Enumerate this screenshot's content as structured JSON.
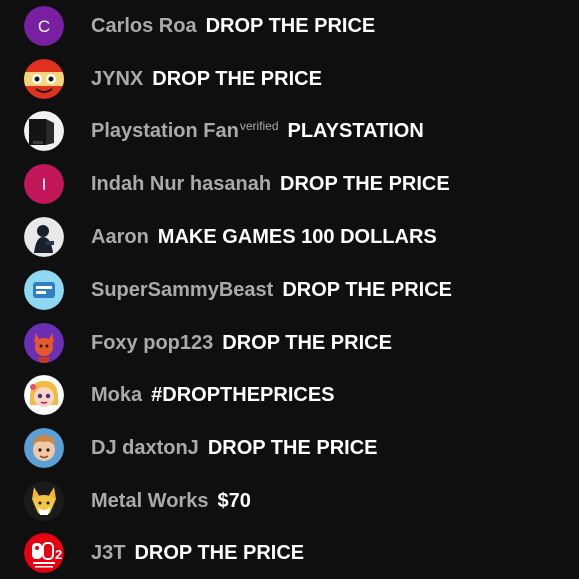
{
  "chat": {
    "messages": [
      {
        "author": "Carlos Roa",
        "badge": "",
        "text": "DROP THE PRICE",
        "avatar": {
          "kind": "letter",
          "letter": "C",
          "color": "#7b1fa2"
        }
      },
      {
        "author": "JYNX",
        "badge": "",
        "text": "DROP THE PRICE",
        "avatar": {
          "kind": "image",
          "icon": "orange-character-avatar-icon"
        }
      },
      {
        "author": "Playstation Fan",
        "badge": "verified",
        "text": "PLAYSTATION",
        "avatar": {
          "kind": "image",
          "icon": "playstation-console-avatar-icon"
        }
      },
      {
        "author": "Indah Nur hasanah",
        "badge": "",
        "text": "DROP THE PRICE",
        "avatar": {
          "kind": "letter",
          "letter": "I",
          "color": "#c2185b"
        }
      },
      {
        "author": "Aaron",
        "badge": "",
        "text": "MAKE GAMES 100 DOLLARS",
        "avatar": {
          "kind": "image",
          "icon": "dark-figure-avatar-icon"
        }
      },
      {
        "author": "SuperSammyBeast",
        "badge": "",
        "text": "DROP THE PRICE",
        "avatar": {
          "kind": "image",
          "icon": "blue-logo-avatar-icon"
        }
      },
      {
        "author": "Foxy pop123",
        "badge": "",
        "text": "DROP THE PRICE",
        "avatar": {
          "kind": "image",
          "icon": "fox-character-avatar-icon"
        }
      },
      {
        "author": "Moka",
        "badge": "",
        "text": "#DROPTHEPRICES",
        "avatar": {
          "kind": "image",
          "icon": "anime-girl-avatar-icon"
        }
      },
      {
        "author": "DJ daxtonJ",
        "badge": "",
        "text": "DROP THE PRICE",
        "avatar": {
          "kind": "image",
          "icon": "cartoon-boy-avatar-icon"
        }
      },
      {
        "author": "Metal Works",
        "badge": "",
        "text": "$70",
        "avatar": {
          "kind": "image",
          "icon": "yellow-fox-avatar-icon"
        }
      },
      {
        "author": "J3T",
        "badge": "",
        "text": "DROP THE PRICE",
        "avatar": {
          "kind": "image",
          "icon": "switch-2-logo-avatar-icon"
        }
      }
    ]
  },
  "colors": {
    "background": "#0f0f0f",
    "author": "#aaaaaa",
    "message": "#ffffff"
  }
}
